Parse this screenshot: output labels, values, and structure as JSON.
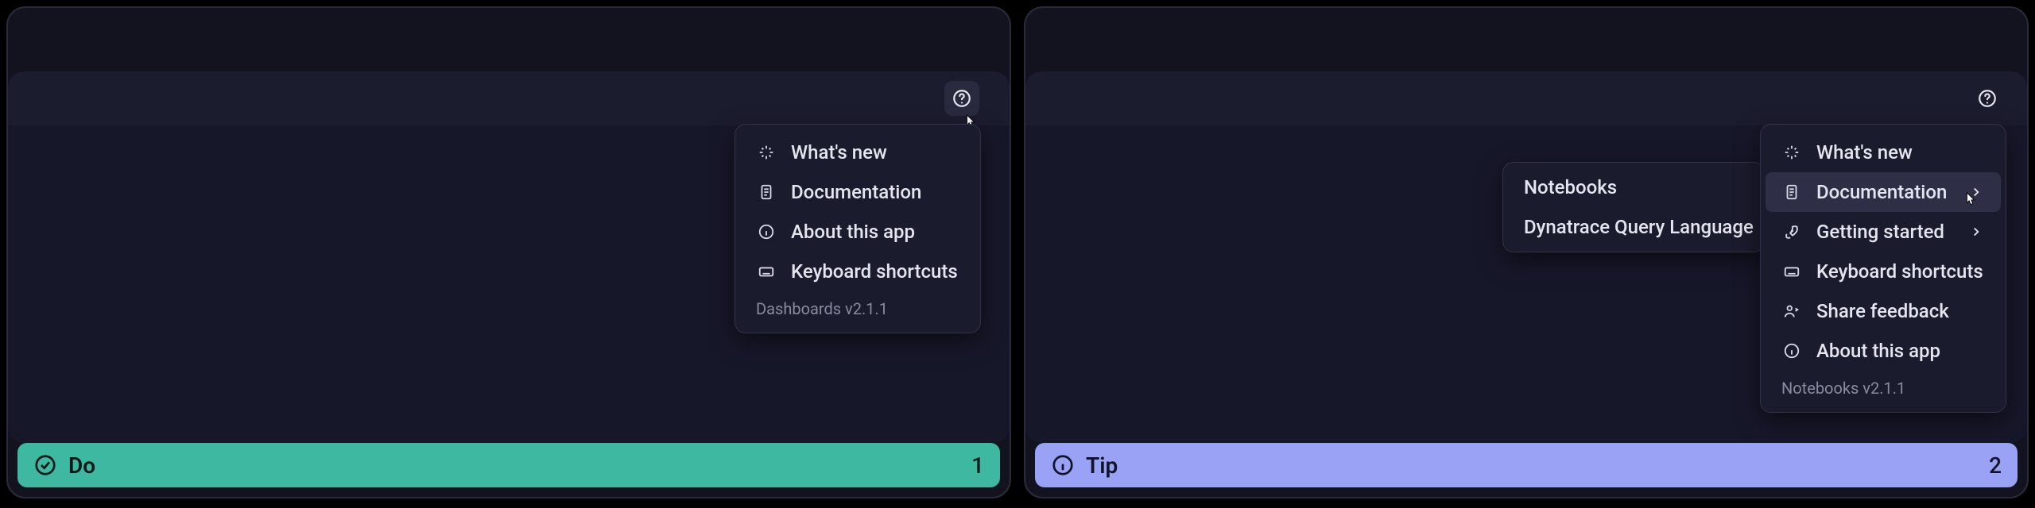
{
  "panels": [
    {
      "status": {
        "label": "Do",
        "number": "1",
        "style": "green"
      },
      "menu": {
        "items": [
          {
            "icon": "sparkle-icon",
            "label": "What's new"
          },
          {
            "icon": "doc-icon",
            "label": "Documentation"
          },
          {
            "icon": "info-icon",
            "label": "About this app"
          },
          {
            "icon": "keyboard-icon",
            "label": "Keyboard shortcuts"
          }
        ],
        "footer": "Dashboards v2.1.1"
      }
    },
    {
      "status": {
        "label": "Tip",
        "number": "2",
        "style": "purple"
      },
      "menu": {
        "items": [
          {
            "icon": "sparkle-icon",
            "label": "What's new"
          },
          {
            "icon": "doc-icon",
            "label": "Documentation",
            "chevron": true,
            "hover": true
          },
          {
            "icon": "rocket-icon",
            "label": "Getting started",
            "chevron": true
          },
          {
            "icon": "keyboard-icon",
            "label": "Keyboard shortcuts"
          },
          {
            "icon": "feedback-icon",
            "label": "Share feedback"
          },
          {
            "icon": "info-icon",
            "label": "About this app"
          }
        ],
        "footer": "Notebooks v2.1.1"
      },
      "submenu": {
        "items": [
          {
            "label": "Notebooks"
          },
          {
            "label": "Dynatrace Query Language"
          }
        ]
      }
    }
  ]
}
